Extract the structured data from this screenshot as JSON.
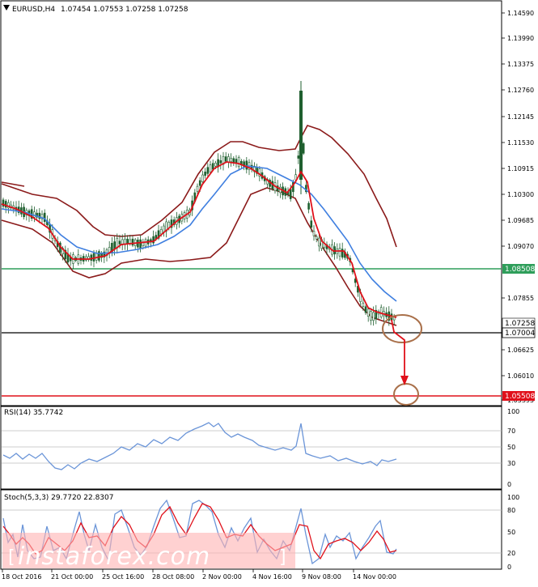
{
  "header": {
    "symbol": "EURUSD,H4",
    "ohlc": "1.07454 1.07553 1.07258 1.07258"
  },
  "price_axis": {
    "ticks": [
      "1.14590",
      "1.13990",
      "1.13375",
      "1.12760",
      "1.12145",
      "1.11530",
      "1.10915",
      "1.10300",
      "1.09685",
      "1.09070",
      "1.07855",
      "1.06625",
      "1.06010",
      "1.05395"
    ]
  },
  "levels": {
    "green": {
      "value": "1.08508",
      "color": "#2e9e5a"
    },
    "black": {
      "value": "1.07004",
      "color": "#000000"
    },
    "red": {
      "value": "1.05508",
      "color": "#e0101a"
    },
    "current": {
      "value": "1.07258"
    }
  },
  "rsi": {
    "title": "RSI(14) 35.7742",
    "ticks": [
      "100",
      "70",
      "50",
      "30",
      "0"
    ]
  },
  "stoch": {
    "title": "Stoch(5,3,3) 29.7720 22.8307",
    "ticks": [
      "100",
      "80",
      "50",
      "20",
      "0"
    ]
  },
  "time_axis": {
    "labels": [
      "18 Oct 2016",
      "21 Oct 00:00",
      "25 Oct 16:00",
      "28 Oct 08:00",
      "2 Nov 00:00",
      "4 Nov 16:00",
      "9 Nov 08:00",
      "14 Nov 00:00"
    ]
  },
  "watermark": "instaforex.com",
  "colors": {
    "bollinger": "#8b1a1a",
    "ma_fast": "#e0101a",
    "ma_slow": "#3f7fe0",
    "candle": "#1f5f2f",
    "indicator": "#6b95d8",
    "watermark_band": "#ffb3b3"
  },
  "chart_data": {
    "type": "line",
    "title": "EURUSD,H4",
    "x": [
      "18 Oct 2016",
      "21 Oct 00:00",
      "25 Oct 16:00",
      "28 Oct 08:00",
      "2 Nov 00:00",
      "4 Nov 16:00",
      "9 Nov 08:00",
      "14 Nov 00:00"
    ],
    "ylim": [
      1.053,
      1.149
    ],
    "series": [
      {
        "values": [
          1.099,
          1.0955,
          1.089,
          1.09,
          1.0975,
          1.105,
          1.1,
          1.086,
          1.076,
          1.0726
        ]
      }
    ],
    "horizontal_levels": [
      1.08508,
      1.07004,
      1.05508
    ],
    "rsi": {
      "ylim": [
        0,
        100
      ],
      "last": 35.7742
    },
    "stochastic": {
      "ylim": [
        0,
        100
      ],
      "main": 29.772,
      "signal": 22.8307
    }
  }
}
